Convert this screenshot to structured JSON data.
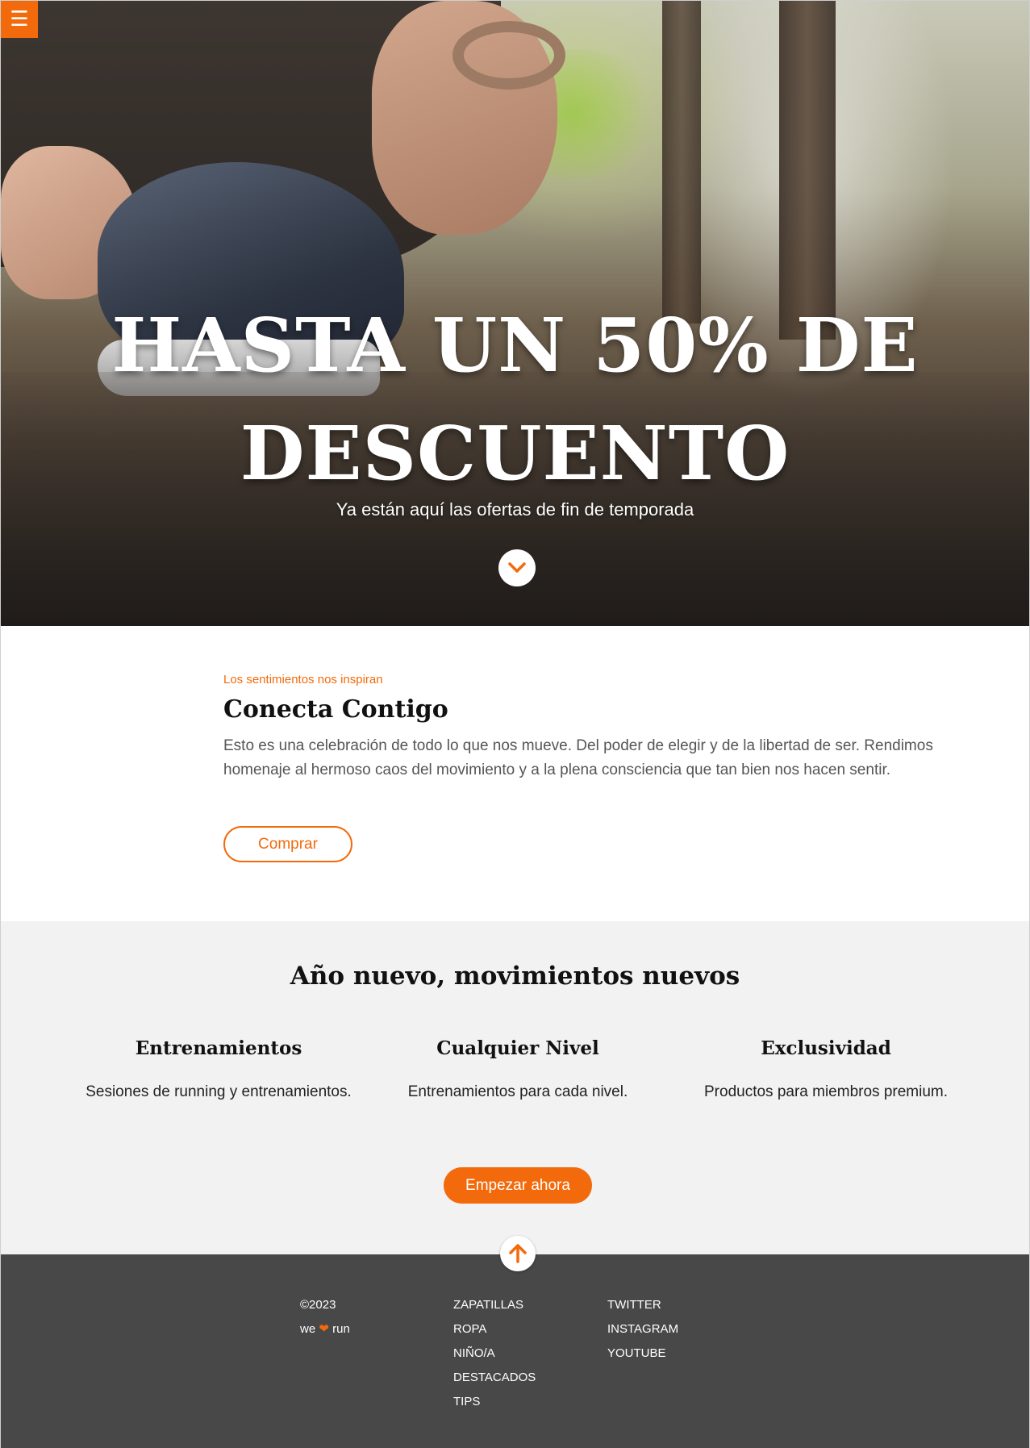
{
  "nav": {
    "menu_icon": "☰"
  },
  "hero": {
    "title_line1": "HASTA UN 50% DE",
    "title_line2": "DESCUENTO",
    "subtitle": "Ya están aquí las ofertas de fin de temporada"
  },
  "intro": {
    "eyebrow": "Los sentimientos nos inspiran",
    "title": "Conecta Contigo",
    "text": "Esto es una celebración de todo lo que nos mueve. Del poder de elegir y de la libertad de ser. Rendimos homenaje al hermoso caos del movimiento y a la plena consciencia que tan bien nos hacen sentir.",
    "button": "Comprar"
  },
  "features": {
    "title": "Año nuevo, movimientos nuevos",
    "items": [
      {
        "title": "Entrenamientos",
        "text": "Sesiones de running y entrenamientos."
      },
      {
        "title": "Cualquier Nivel",
        "text": "Entrenamientos para cada nivel."
      },
      {
        "title": "Exclusividad",
        "text": "Productos para miembros premium."
      }
    ],
    "cta": "Empezar ahora"
  },
  "footer": {
    "copyright": "©2023",
    "tagline_pre": "we",
    "tagline_heart": "❤",
    "tagline_post": "run",
    "links": [
      "ZAPATILLAS",
      "ROPA",
      "NIÑO/A",
      "DESTACADOS",
      "TIPS"
    ],
    "social": [
      "TWITTER",
      "INSTAGRAM",
      "YOUTUBE"
    ]
  },
  "colors": {
    "accent": "#f26a0b",
    "footer_bg": "#484848",
    "section_bg": "#f2f2f2"
  },
  "icons": {
    "menu": "menu-icon",
    "down": "chevron-down-icon",
    "up": "arrow-up-icon",
    "heart": "heart-icon"
  }
}
